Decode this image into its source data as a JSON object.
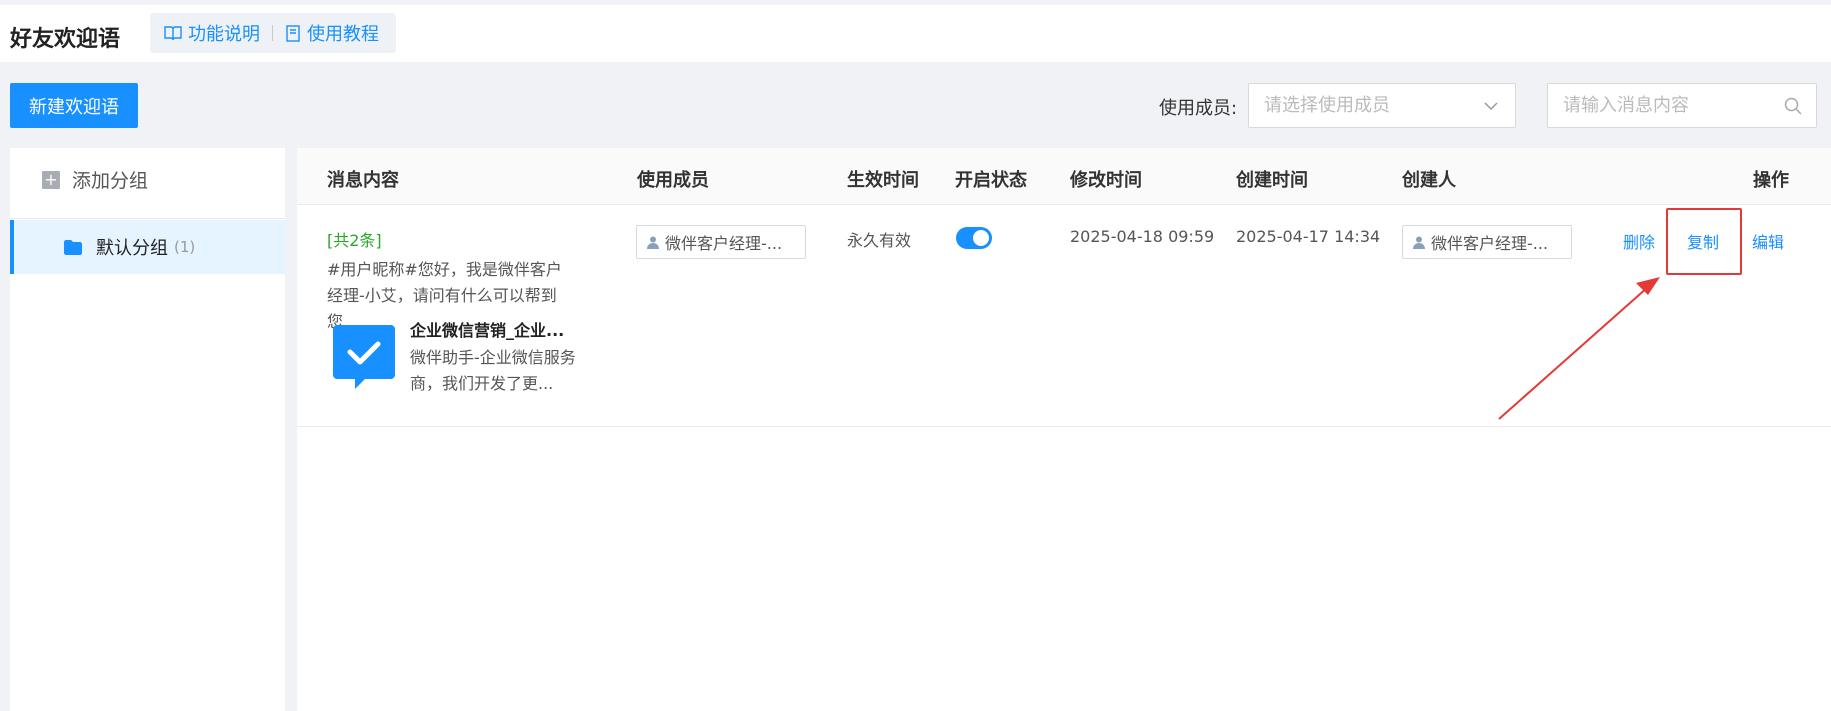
{
  "header": {
    "title": "好友欢迎语",
    "links": [
      {
        "label": "功能说明",
        "icon": "book-open-icon"
      },
      {
        "label": "使用教程",
        "icon": "document-icon"
      }
    ]
  },
  "toolbar": {
    "new_button_label": "新建欢迎语",
    "member_filter_label": "使用成员:",
    "member_filter_placeholder": "请选择使用成员",
    "search_placeholder": "请输入消息内容"
  },
  "sidebar": {
    "add_group_label": "添加分组",
    "groups": [
      {
        "name": "默认分组",
        "count": "(1)",
        "selected": true
      }
    ]
  },
  "table": {
    "columns": [
      "消息内容",
      "使用成员",
      "生效时间",
      "开启状态",
      "修改时间",
      "创建时间",
      "创建人",
      "操作"
    ],
    "rows": [
      {
        "count_tag": "[共2条]",
        "message_text": "#用户昵称#您好，我是微伴客户经理-小艾，请问有什么可以帮到您...",
        "card_title": "企业微信营销_企业...",
        "card_desc": "微伴助手-企业微信服务商，我们开发了更...",
        "member": "微伴客户经理-...",
        "effective_time": "永久有效",
        "enabled": true,
        "modified_time": "2025-04-18 09:59",
        "created_time": "2025-04-17 14:34",
        "creator": "微伴客户经理-...",
        "actions": {
          "delete": "删除",
          "copy": "复制",
          "edit": "编辑"
        }
      }
    ]
  },
  "colors": {
    "primary": "#1890ff",
    "highlight": "#e53935",
    "tag_green": "#2aa72a"
  }
}
